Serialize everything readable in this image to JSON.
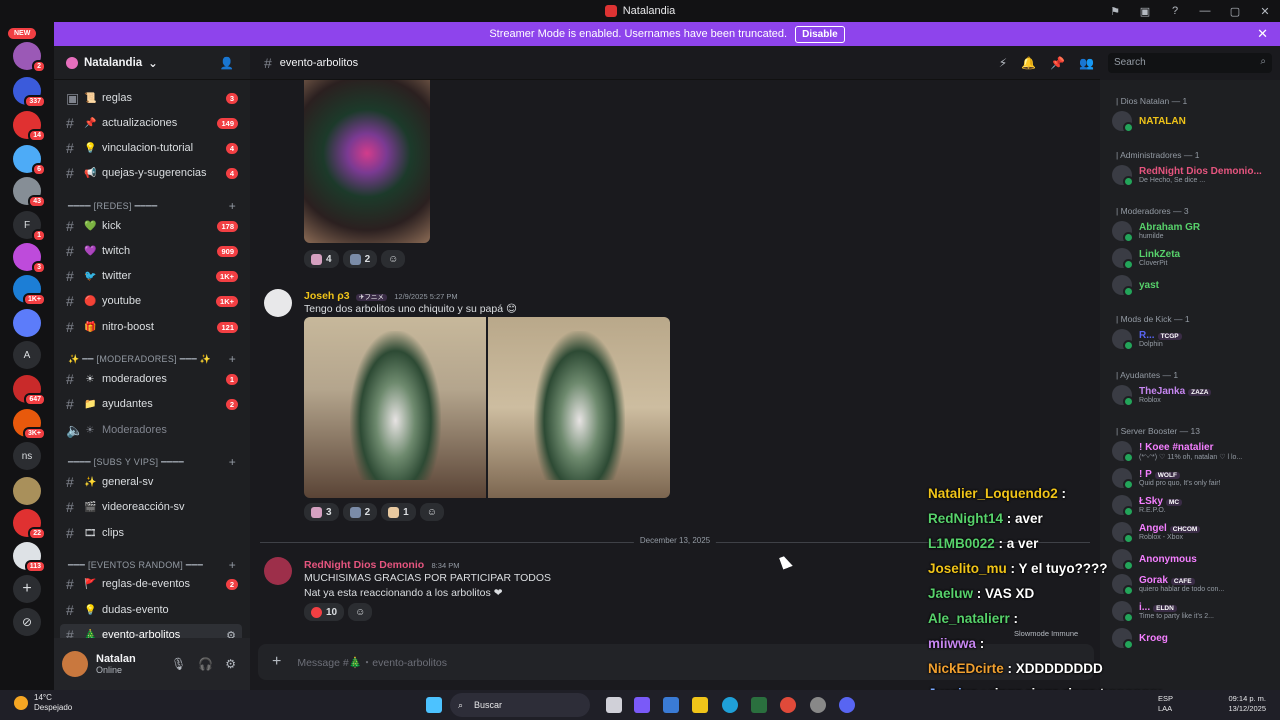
{
  "window": {
    "title": "Natalandia",
    "controls": [
      "—",
      "▢",
      "✕"
    ]
  },
  "banner": {
    "text": "Streamer Mode is enabled. Usernames have been truncated.",
    "button": "Disable"
  },
  "servers": {
    "new_label": "NEW",
    "badges": [
      "2",
      "337",
      "14",
      "6",
      "43",
      "1",
      "3",
      "1K+",
      "647",
      "3K+",
      "1",
      "22",
      "113"
    ],
    "letters": [
      "A",
      "ns"
    ]
  },
  "server": {
    "name": "Natalandia"
  },
  "channels": [
    {
      "name": "reglas",
      "emoji": "📜",
      "count": "3"
    },
    {
      "name": "actualizaciones",
      "emoji": "📌",
      "count": "149"
    },
    {
      "name": "vinculacion-tutorial",
      "emoji": "💡",
      "count": "4"
    },
    {
      "name": "quejas-y-sugerencias",
      "emoji": "📢",
      "count": "4"
    }
  ],
  "cat_redes": "━━━━ [REDES] ━━━━",
  "channels_redes": [
    {
      "name": "kick",
      "emoji": "💚",
      "count": "178"
    },
    {
      "name": "twitch",
      "emoji": "💜",
      "count": "909"
    },
    {
      "name": "twitter",
      "emoji": "🐦",
      "count": "1K+"
    },
    {
      "name": "youtube",
      "emoji": "🔴",
      "count": "1K+"
    },
    {
      "name": "nitro-boost",
      "emoji": "🎁",
      "count": "121"
    }
  ],
  "cat_mods": "✨ ━━ [MODERADORES] ━━━ ✨",
  "channels_mods": [
    {
      "name": "moderadores",
      "emoji": "☀",
      "count": "1"
    },
    {
      "name": "ayudantes",
      "emoji": "📁",
      "count": "2"
    },
    {
      "name": "Moderadores",
      "emoji": "☀",
      "count": ""
    }
  ],
  "cat_subs": "━━━━ [SUBS Y VIPS] ━━━━",
  "channels_subs": [
    {
      "name": "general-sv",
      "emoji": "✨",
      "count": ""
    },
    {
      "name": "videoreacción-sv",
      "emoji": "🎬",
      "count": ""
    },
    {
      "name": "clips",
      "emoji": "🎞",
      "count": ""
    }
  ],
  "cat_eventos": "━━━ [EVENTOS RANDOM] ━━━",
  "channels_eventos": [
    {
      "name": "reglas-de-eventos",
      "emoji": "🚩",
      "count": "2"
    },
    {
      "name": "dudas-evento",
      "emoji": "💡",
      "count": ""
    },
    {
      "name": "evento-arbolitos",
      "emoji": "🎄",
      "count": ""
    }
  ],
  "user": {
    "name": "Natalan",
    "status": "Online"
  },
  "chat": {
    "channel": "evento-arbolitos",
    "search_placeholder": "Search",
    "composer_placeholder": "Message #🎄・evento-arbolitos",
    "reactions1": [
      {
        "count": "4"
      },
      {
        "count": "2"
      }
    ],
    "msg1": {
      "author": "Joseh ρ3",
      "tag": "✈フニメ",
      "time": "12/9/2025 5:27 PM",
      "text": "Tengo dos arbolitos uno chiquito y su papá 😊",
      "reactions": [
        "3",
        "2",
        "1"
      ]
    },
    "divider": "December 13, 2025",
    "msg2": {
      "author": "RedNight Dios Demonio",
      "time": "8:34 PM",
      "line1": "MUCHISIMAS GRACIAS POR PARTICIPAR TODOS",
      "line2": "Nat ya esta reaccionando a los arbolitos ❤",
      "reaction": "10"
    }
  },
  "members": {
    "groups": [
      {
        "title": "| Dios Natalan — 1",
        "members": [
          {
            "name": "NATALAN",
            "sub": "",
            "color": "#f0c419"
          }
        ]
      },
      {
        "title": "| Administradores — 1",
        "members": [
          {
            "name": "RedNight Dios Demonio...",
            "sub": "De Hecho, Se dice ...",
            "color": "#e6557f"
          }
        ]
      },
      {
        "title": "| Moderadores — 3",
        "members": [
          {
            "name": "Abraham GR",
            "sub": "humilde",
            "color": "#57d16b"
          },
          {
            "name": "LinkZeta",
            "sub": "CloverPit",
            "color": "#57d16b"
          },
          {
            "name": "yast",
            "sub": "",
            "color": "#57d16b"
          }
        ]
      },
      {
        "title": "| Mods de Kick — 1",
        "members": [
          {
            "name": "R...",
            "sub": "Dolphin",
            "tag": "TCGP",
            "color": "#5865f2"
          }
        ]
      },
      {
        "title": "| Ayudantes — 1",
        "members": [
          {
            "name": "TheJanka",
            "sub": "Roblox",
            "tag": "ZAZA",
            "color": "#c686f0"
          }
        ]
      },
      {
        "title": "| Server Booster — 13",
        "members": [
          {
            "name": "! Koee #natalier",
            "sub": "(*ᵔᵕᵔ*) ♡ 11% oh, natalan ♡ l lo...",
            "color": "#f47fff"
          },
          {
            "name": "! P",
            "sub": "Quid pro quo, It's only fair!",
            "tag": "WOLF",
            "color": "#f47fff"
          },
          {
            "name": "ŁSky",
            "sub": "R.E.P.O.",
            "tag": "MC",
            "color": "#f47fff"
          },
          {
            "name": "Angel",
            "sub": "Roblox - Xbox",
            "tag": "CHCOM",
            "color": "#f47fff"
          },
          {
            "name": "Anonymous",
            "sub": "",
            "color": "#f47fff"
          },
          {
            "name": "Gorak",
            "sub": "quiero hablar de todo con...",
            "tag": "CAFE",
            "color": "#f47fff"
          },
          {
            "name": "i...",
            "sub": "Time to party like it's 2...",
            "tag": "ELDN",
            "color": "#f47fff"
          },
          {
            "name": "Kroeg",
            "sub": "",
            "color": "#f47fff"
          }
        ]
      }
    ]
  },
  "overlay": [
    {
      "name": "Natalier_Loquendo2",
      "text": "",
      "color": "#f0c419"
    },
    {
      "name": "RedNight14",
      "text": "aver",
      "color": "#57d16b"
    },
    {
      "name": "L1MB0022",
      "text": "a ver",
      "color": "#57d16b"
    },
    {
      "name": "Joselito_mu",
      "text": "Y el tuyo????",
      "color": "#f0c419"
    },
    {
      "name": "Jaeluw",
      "text": "VAS XD",
      "color": "#57d16b"
    },
    {
      "name": "Ale_natalierr",
      "text": "",
      "color": "#57d16b"
    },
    {
      "name": "miiwwa",
      "text": "",
      "color": "#c686f0"
    },
    {
      "name": "NickEDcirte",
      "text": "XDDDDDDDD",
      "color": "#f0a030"
    },
    {
      "name": "Juazjua",
      "text": "ringa ringa ringa tuuuuuuu",
      "color": "#7aa9ff"
    }
  ],
  "slowmode": "Slowmode Immune",
  "taskbar": {
    "temp": "14°C",
    "weather": "Despejado",
    "search": "Buscar",
    "lang1": "ESP",
    "lang2": "LAA",
    "time": "09:14 p. m.",
    "date": "13/12/2025"
  }
}
